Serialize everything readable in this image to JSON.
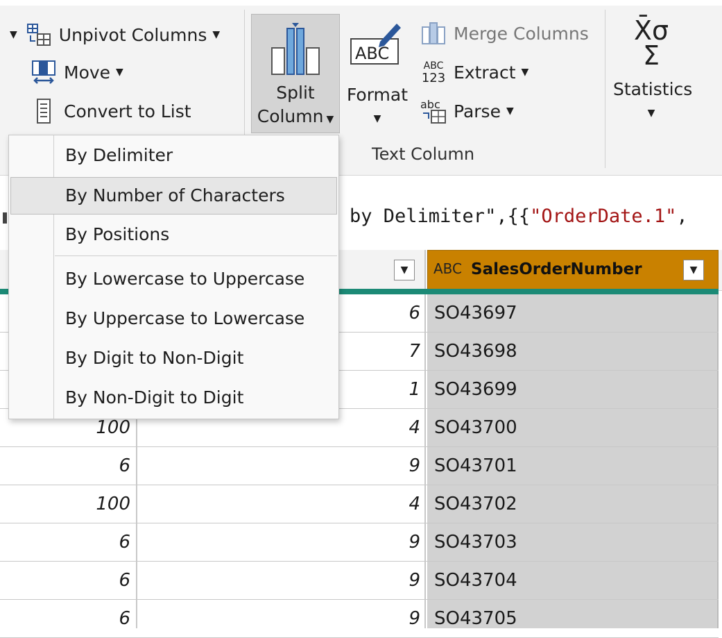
{
  "ribbon": {
    "unpivot_label": "Unpivot Columns",
    "move_label": "Move",
    "convert_label": "Convert to List",
    "split_line1": "Split",
    "split_line2": "Column",
    "format_label": "Format",
    "merge_label": "Merge Columns",
    "extract_label": "Extract",
    "parse_label": "Parse",
    "statistics_label": "Statistics",
    "text_column_group": "Text Column",
    "format_icon_text": "ABC",
    "extract_icon_top": "ABC",
    "extract_icon_bottom": "123",
    "parse_icon_text": "abc",
    "stats_icon_top": "X̄σ",
    "stats_icon_bottom": "Σ"
  },
  "split_menu": {
    "items": [
      {
        "label": "By Delimiter",
        "highlighted": false
      },
      {
        "label": "By Number of Characters",
        "highlighted": true
      },
      {
        "label": "By Positions",
        "highlighted": false
      },
      {
        "label": "By Lowercase to Uppercase",
        "highlighted": false
      },
      {
        "label": "By Uppercase to Lowercase",
        "highlighted": false
      },
      {
        "label": "By Digit to Non-Digit",
        "highlighted": false
      },
      {
        "label": "By Non-Digit to Digit",
        "highlighted": false
      }
    ]
  },
  "formula": {
    "prefix": "by Delimiter\",{{",
    "string": "\"OrderDate.1\"",
    "suffix": ", "
  },
  "grid": {
    "selected_column": {
      "type_icon": "ABC",
      "name": "SalesOrderNumber"
    },
    "rows": [
      {
        "a": "",
        "b": "6",
        "so": "SO43697"
      },
      {
        "a": "",
        "b": "7",
        "so": "SO43698"
      },
      {
        "a": "",
        "b": "1",
        "so": "SO43699"
      },
      {
        "a": "100",
        "b": "4",
        "so": "SO43700"
      },
      {
        "a": "6",
        "b": "9",
        "so": "SO43701"
      },
      {
        "a": "100",
        "b": "4",
        "so": "SO43702"
      },
      {
        "a": "6",
        "b": "9",
        "so": "SO43703"
      },
      {
        "a": "6",
        "b": "9",
        "so": "SO43704"
      },
      {
        "a": "6",
        "b": "9",
        "so": "SO43705"
      }
    ]
  },
  "colors": {
    "selected_header": "#c98100",
    "accent_teal": "#1c8a76",
    "split_active": "#d4d4d4"
  }
}
